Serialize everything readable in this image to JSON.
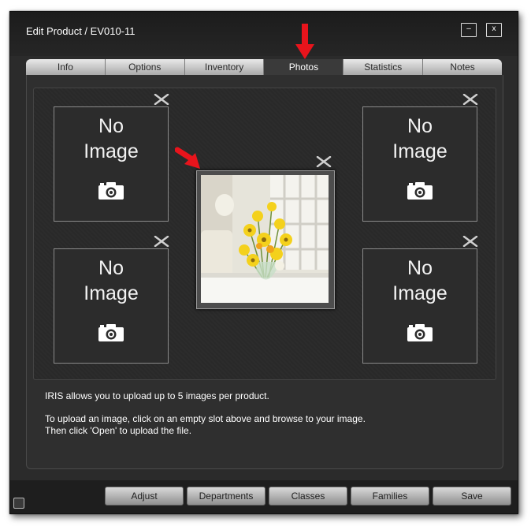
{
  "window": {
    "title": "Edit Product / EV010-11",
    "minimize_label": "–",
    "close_label": "x"
  },
  "tabs": [
    {
      "label": "Info",
      "active": false
    },
    {
      "label": "Options",
      "active": false
    },
    {
      "label": "Inventory",
      "active": false
    },
    {
      "label": "Photos",
      "active": true
    },
    {
      "label": "Statistics",
      "active": false
    },
    {
      "label": "Notes",
      "active": false
    }
  ],
  "photos": {
    "empty_line1": "No",
    "empty_line2": "Image",
    "slot_icon": "camera-icon",
    "delete_icon": "delete-x-icon"
  },
  "info": {
    "line1": "IRIS allows you to upload up to 5 images per product.",
    "line2": "To upload an image, click on an empty slot above and browse to your image.",
    "line3": "Then click 'Open' to upload the file."
  },
  "buttons": {
    "adjust": "Adjust",
    "departments": "Departments",
    "classes": "Classes",
    "families": "Families",
    "save": "Save"
  },
  "colors": {
    "annotation_arrow": "#e8141c",
    "window_bg": "#2b2b2b"
  }
}
